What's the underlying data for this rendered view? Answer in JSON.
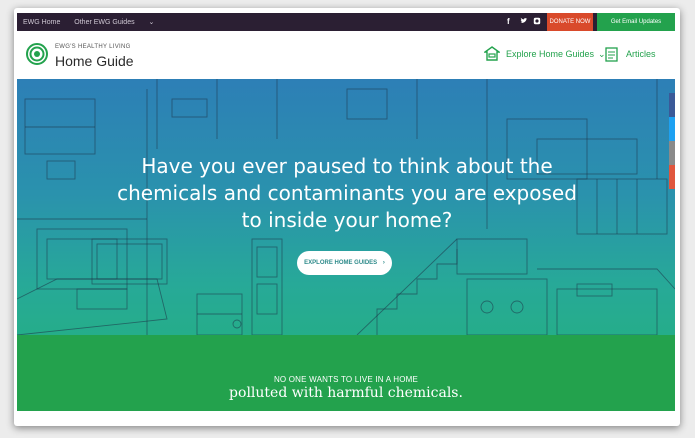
{
  "topbar": {
    "links": [
      "EWG Home",
      "Other EWG Guides"
    ],
    "social_icons": [
      "facebook-icon",
      "twitter-icon",
      "instagram-icon"
    ],
    "donate_label": "DONATE NOW",
    "updates_label": "Get Email Updates"
  },
  "header": {
    "brand_small": "EWG'S HEALTHY LIVING",
    "brand_big": "Home Guide",
    "nav_guides": "Explore Home Guides",
    "nav_articles": "Articles"
  },
  "hero": {
    "title": "Have you ever paused to think about the chemicals and contaminants you are exposed to inside your home?",
    "button": "EXPLORE HOME GUIDES"
  },
  "band": {
    "small": "NO ONE WANTS TO LIVE IN A HOME",
    "big": "polluted with harmful chemicals."
  },
  "colors": {
    "topbar_bg": "#2b1f33",
    "accent_green": "#23a24d",
    "donate_red": "#d94a2b",
    "hero_top": "#2d7fb6",
    "hero_bottom": "#25ad8a"
  },
  "side_tabs": [
    "#3b5998",
    "#1da1f2",
    "#8a8a8a",
    "#e0563d"
  ]
}
